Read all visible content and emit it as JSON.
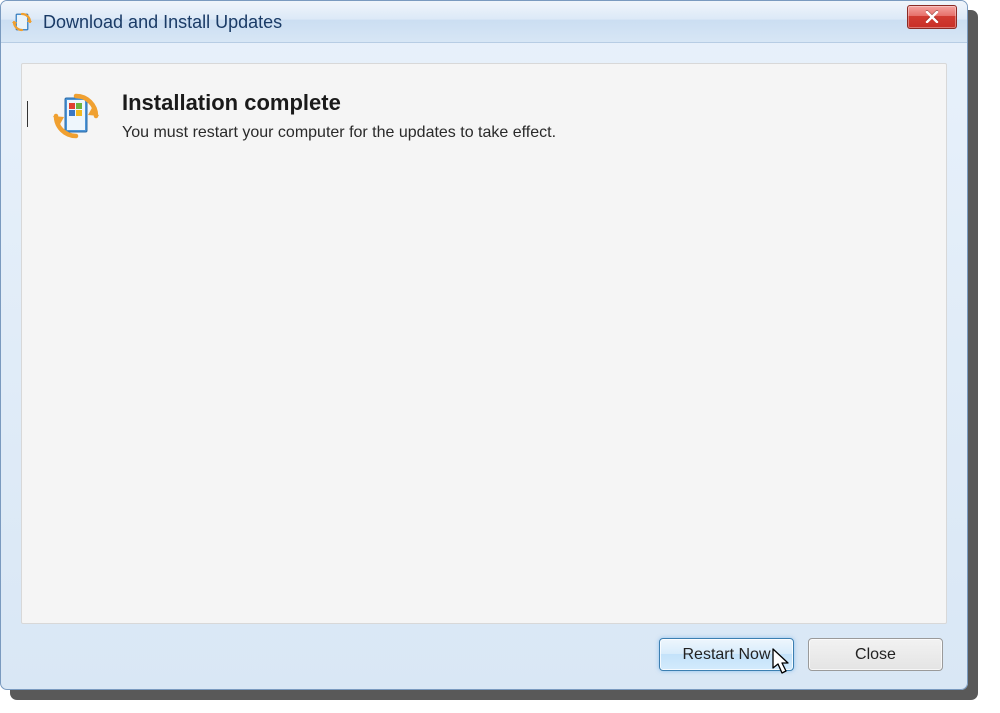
{
  "window": {
    "title": "Download and Install Updates"
  },
  "content": {
    "heading": "Installation complete",
    "subtext": "You must restart your computer for the updates to take effect."
  },
  "buttons": {
    "restart": "Restart Now",
    "close": "Close"
  }
}
